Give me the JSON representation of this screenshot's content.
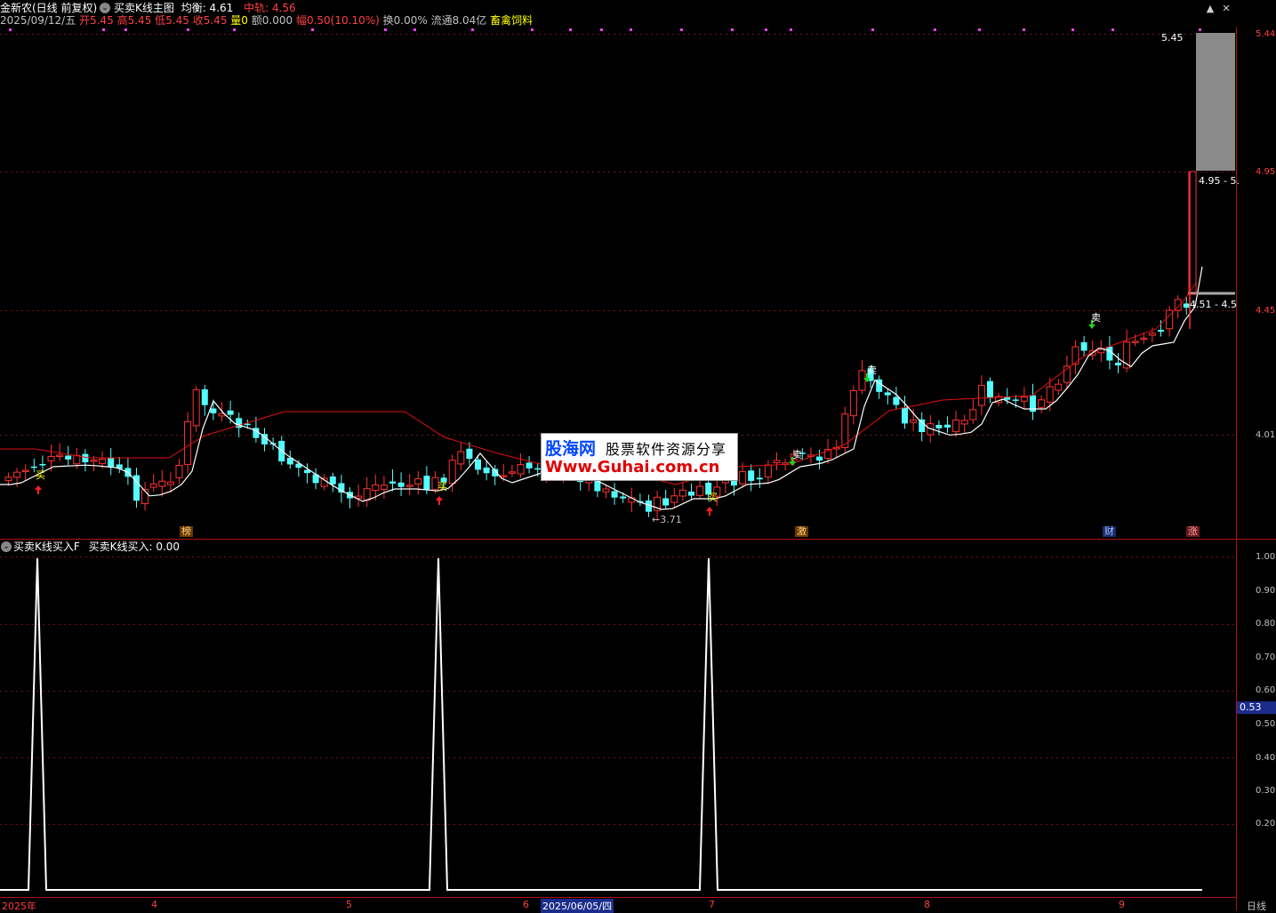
{
  "header": {
    "stock_name": "金新农(日线 前复权)",
    "formula_name": "买卖K线主图",
    "junheng": "均衡: 4.61",
    "zhonggui": "中轨: 4.56",
    "date": "2025/09/12/五",
    "open": "开5.45",
    "high": "高5.45",
    "low": "低5.45",
    "close": "收5.45",
    "volume": "量0",
    "amount": "额0.000",
    "change": "幅0.50(10.10%)",
    "turnover": "换0.00%",
    "float_cap": "流通8.04亿",
    "concept": "畜禽饲料"
  },
  "sub_header": {
    "indicator": "买卖K线买入F",
    "value": "买卖K线买入: 0.00"
  },
  "price_axis": [
    "5.44",
    "4.95",
    "4.45",
    "4.01"
  ],
  "sub_axis": [
    "1.00",
    "0.90",
    "0.80",
    "0.70",
    "0.60",
    "0.50",
    "0.40",
    "0.30",
    "0.20"
  ],
  "sub_axis_current": "0.53",
  "x_axis": [
    "2025年",
    "4",
    "5",
    "6",
    "2025/06/05/四",
    "7",
    "8",
    "9",
    "日线"
  ],
  "annotations": {
    "price_top": "5.45",
    "range_1": "4.95 - 5.",
    "range_2": "4.51 - 4.5",
    "low_mark": "←3.71"
  },
  "signals": {
    "buy": "买",
    "sell": "卖"
  },
  "badges": {
    "bang": "榜",
    "ji": "激",
    "cai": "财",
    "zhang": "涨"
  },
  "watermark": {
    "logo": "股海网",
    "tagline": "股票软件资源分享",
    "url": "Www.Guhai.com.cn"
  },
  "colors": {
    "up": "#ff3232",
    "down": "#54ffff",
    "ma_white": "#ffffff",
    "ma_red": "#e01010",
    "grid": "#7a1010"
  }
}
